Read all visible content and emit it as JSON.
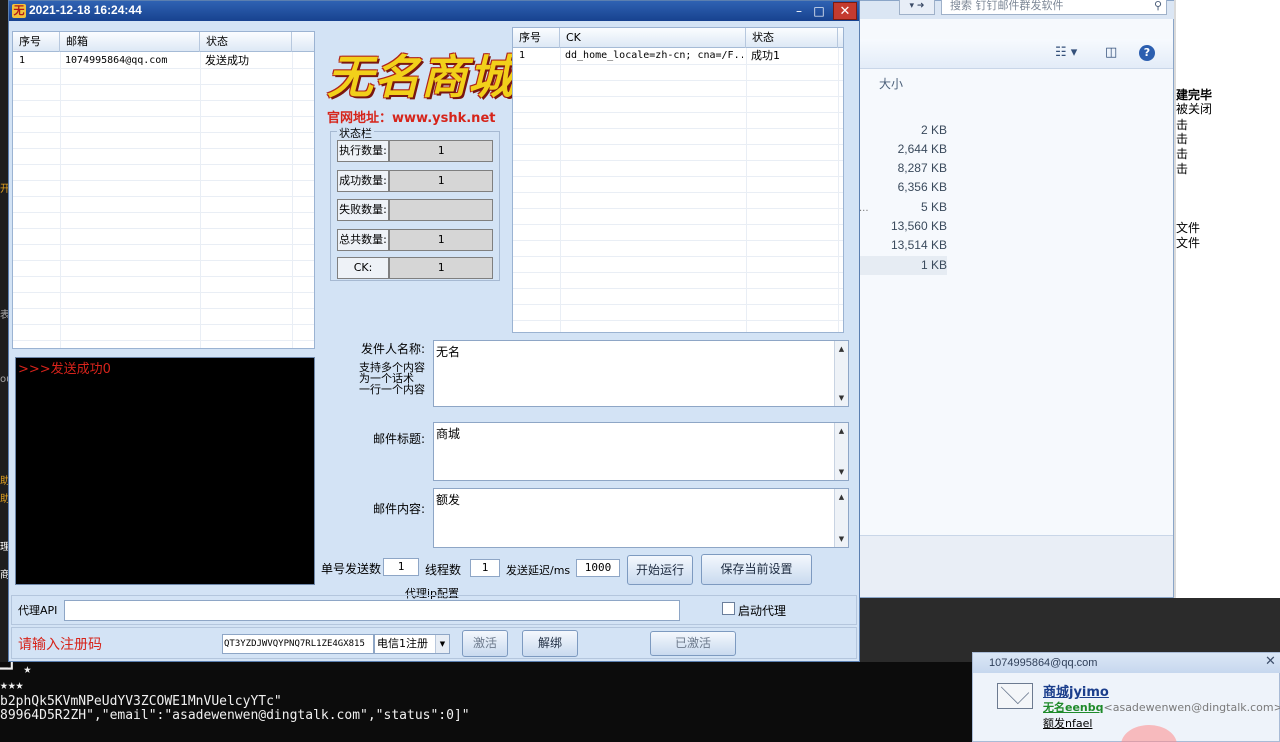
{
  "app": {
    "title": "2021-12-18 16:24:44",
    "title_icon": "无",
    "window_buttons": {
      "minimize": "–",
      "maximize": "□",
      "close": "✕"
    },
    "email_table": {
      "headers": [
        "序号",
        "邮箱",
        "状态"
      ],
      "rows": [
        {
          "index": "1",
          "email": "1074995864@qq.com",
          "status": "发送成功"
        }
      ]
    },
    "ck_table": {
      "headers": [
        "序号",
        "CK",
        "状态"
      ],
      "rows": [
        {
          "index": "1",
          "ck": "dd_home_locale=zh-cn; cna=/F...",
          "status": "成功1"
        }
      ]
    },
    "logo": {
      "text": "无名商城",
      "url_line": "官网地址：www.yshk.net"
    },
    "status_panel": {
      "legend": "状态栏",
      "rows": [
        {
          "label": "执行数量:",
          "value": "1"
        },
        {
          "label": "成功数量:",
          "value": "1"
        },
        {
          "label": "失败数量:",
          "value": ""
        },
        {
          "label": "总共数量:",
          "value": "1"
        },
        {
          "label": "CK:",
          "value": "1"
        }
      ]
    },
    "console_text": ">>>发送成功0",
    "form": {
      "sender_label": "发件人名称:",
      "sender_value": "无名",
      "hint_line1": "支持多个内容",
      "hint_line2": "为一个话术",
      "hint_line3": "一行一个内容",
      "subject_label": "邮件标题:",
      "subject_value": "商城",
      "content_label": "邮件内容:",
      "content_value": "额发"
    },
    "controls": {
      "per_account_label": "单号发送数",
      "per_account_value": "1",
      "threads_label": "线程数",
      "threads_value": "1",
      "delay_label": "发送延迟/ms",
      "delay_value": "1000",
      "start_button": "开始运行",
      "save_button": "保存当前设置"
    },
    "proxy": {
      "group_title": "代理ip配置",
      "api_label": "代理API",
      "api_value": "",
      "enable_label": "启动代理"
    },
    "registration": {
      "prompt": "请输入注册码",
      "code_value": "QT3YZDJWVQYPNQ7RL1ZE4GX815",
      "carrier_option": "电信1注册",
      "activate_button": "激活",
      "unbind_button": "解绑",
      "activated_button": "已激活"
    }
  },
  "explorer": {
    "search_placeholder": "搜索 钉钉邮件群发软件",
    "column_size": "大小",
    "sizes": [
      "2 KB",
      "2,644 KB",
      "8,287 KB",
      "6,356 KB",
      "5 KB",
      "13,560 KB",
      "13,514 KB",
      "1 KB"
    ],
    "dots": "..."
  },
  "right_panel": {
    "lines": [
      "建完毕",
      "被关闭",
      "击",
      "击",
      "击",
      "击",
      "文件",
      "文件"
    ]
  },
  "left_strip": {
    "glyphs": [
      "开",
      "表",
      "ou",
      "助",
      "助",
      "理",
      "商"
    ]
  },
  "console_bottom": {
    "stars1": "━┛ ★",
    "stars2": "★★★",
    "line1": "b2phQk5KVmNPeUdYV3ZCOWE1MnVUelcyYTc\"",
    "line2": "89964D5R2ZH\",\"email\":\"asadewenwen@dingtalk.com\",\"status\":0]\""
  },
  "notification": {
    "header": "1074995864@qq.com",
    "close": "✕",
    "subject": "商城jyimo",
    "from_name": "无名eenbq",
    "from_addr": "<asadewenwen@dingtalk.com>",
    "body": "额发nfael"
  },
  "colors": {
    "titlebar": "#17428f",
    "window_bg": "#d3e3f5",
    "console_text": "#d8231b",
    "logo_yellow": "#f2d01a",
    "logo_red": "#b0231a"
  }
}
